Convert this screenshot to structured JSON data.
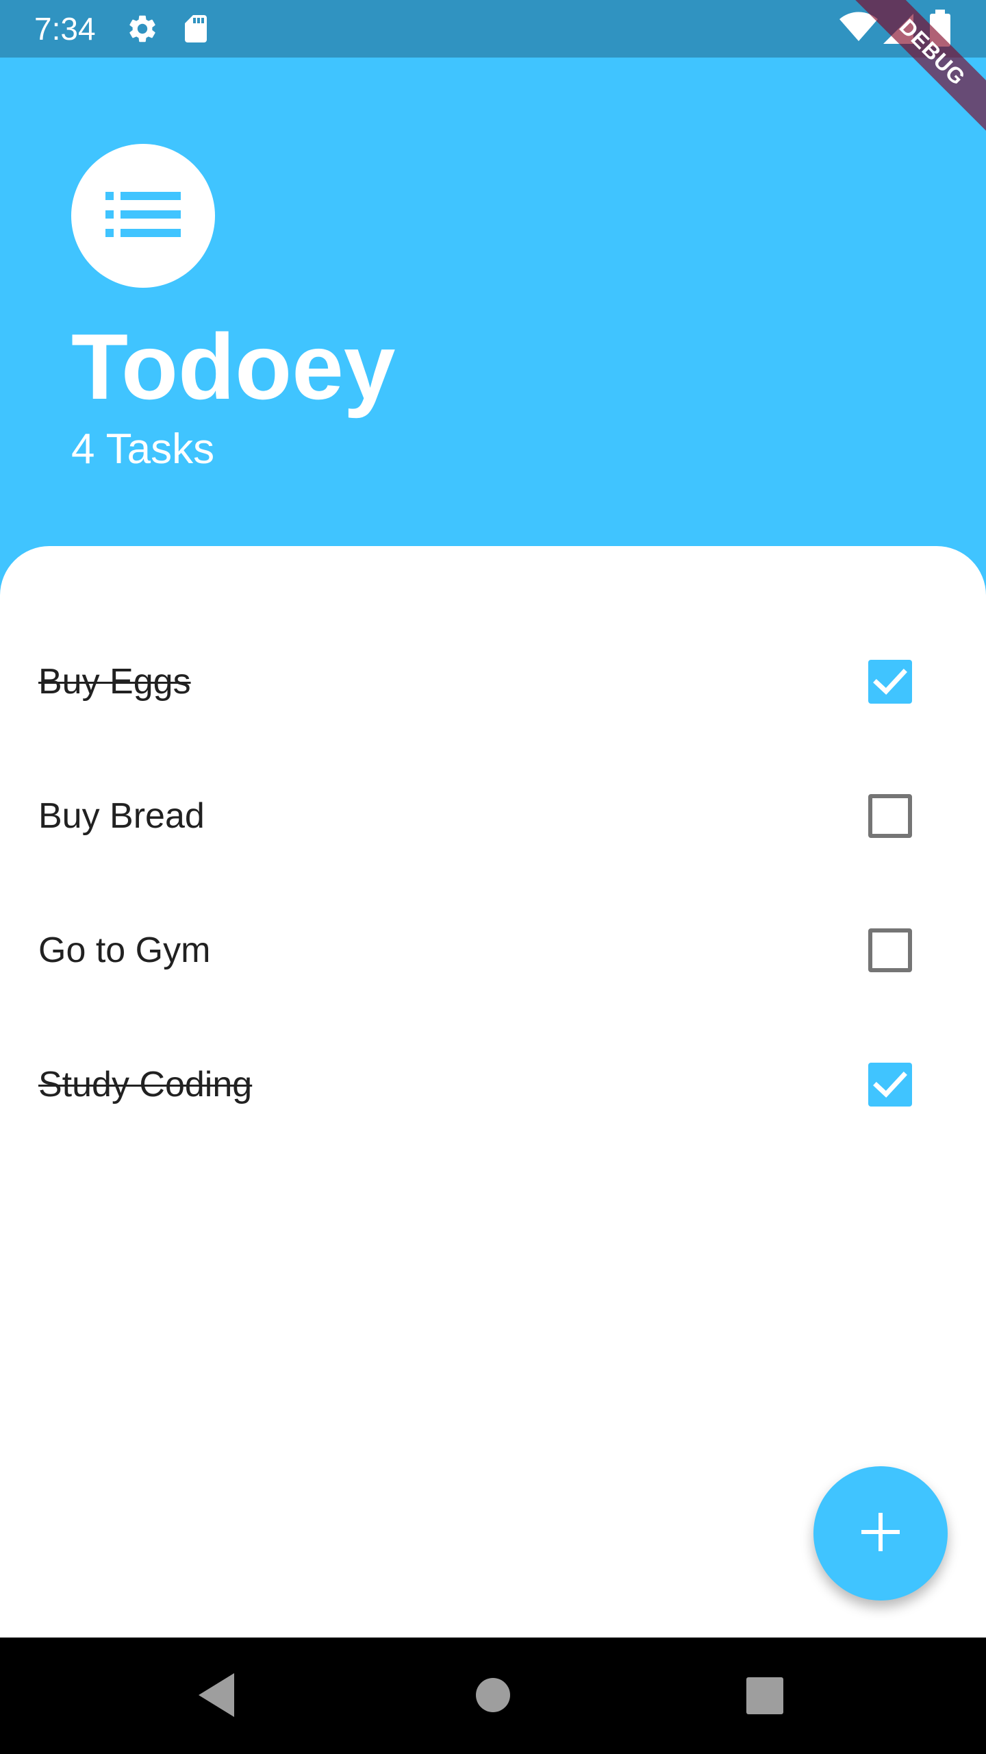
{
  "status_bar": {
    "time": "7:34",
    "icons": [
      "gear-icon",
      "sd-card-icon",
      "wifi-icon",
      "signal-icon",
      "battery-icon"
    ],
    "background": "#3093C1"
  },
  "debug_banner": {
    "label": "DEBUG"
  },
  "header": {
    "icon": "list-icon",
    "title": "Todoey",
    "subtitle": "4 Tasks"
  },
  "tasks": [
    {
      "title": "Buy Eggs",
      "done": true
    },
    {
      "title": "Buy Bread",
      "done": false
    },
    {
      "title": "Go to Gym",
      "done": false
    },
    {
      "title": "Study Coding",
      "done": true
    }
  ],
  "fab": {
    "icon": "add-icon"
  },
  "nav_bar": {
    "icons": [
      "back-icon",
      "home-icon",
      "recents-icon"
    ]
  },
  "colors": {
    "accent": "#40C4FF",
    "unchecked_border": "#757575",
    "text": "#212121"
  }
}
